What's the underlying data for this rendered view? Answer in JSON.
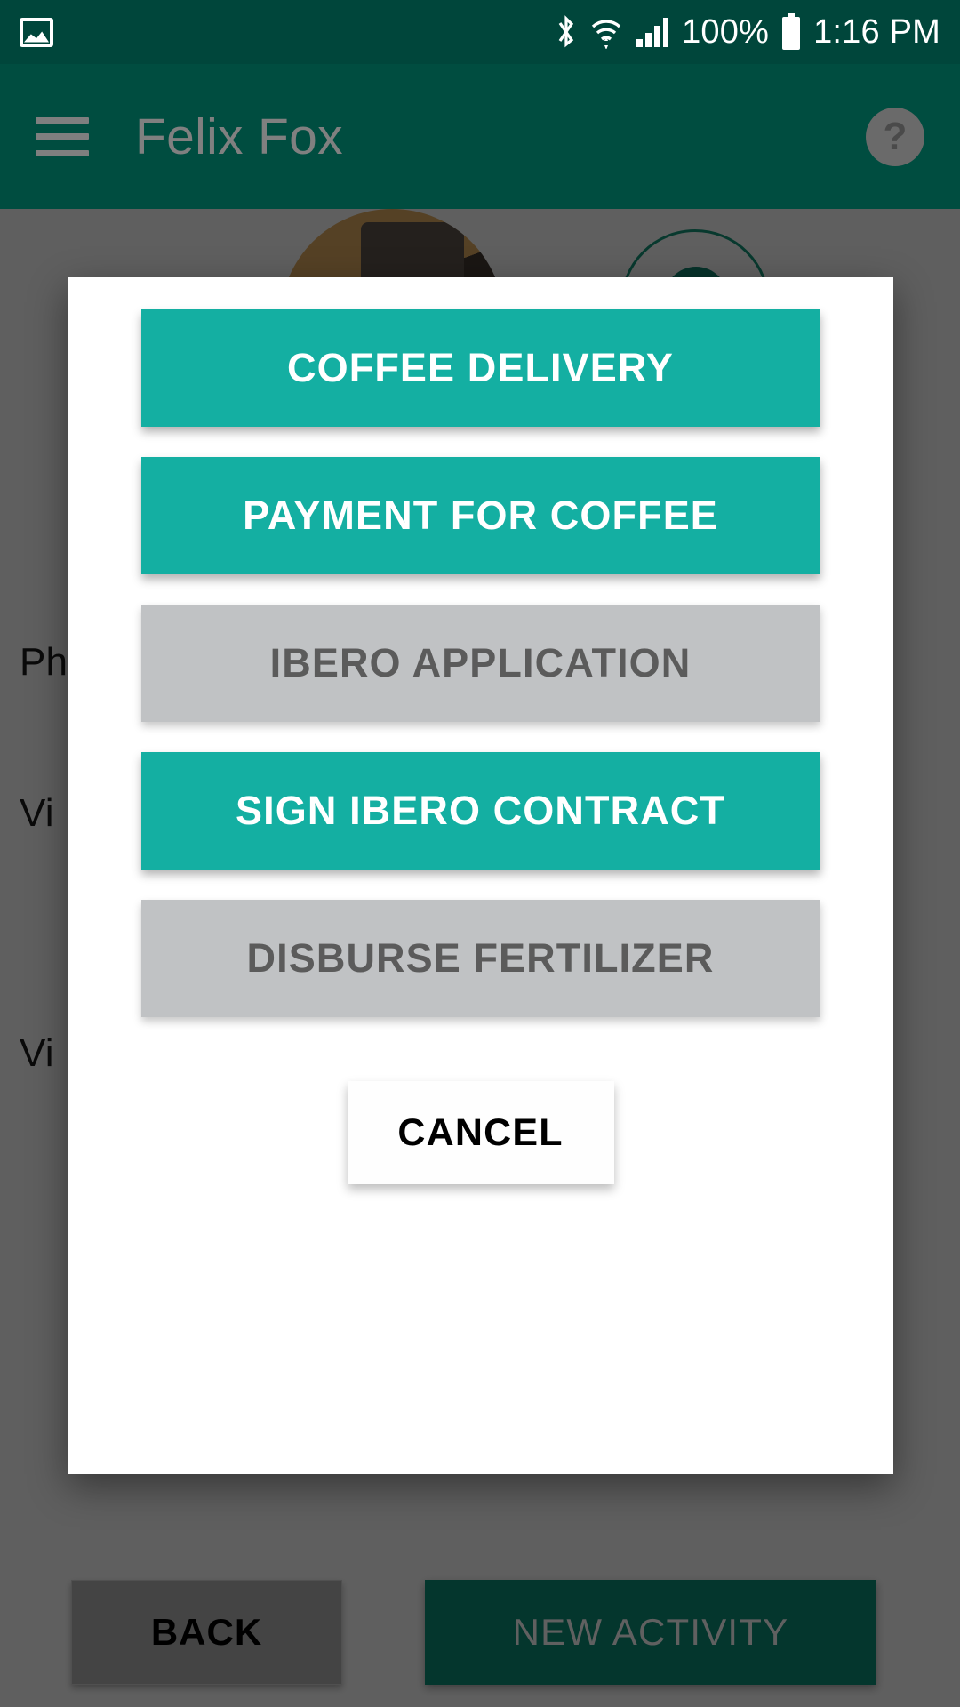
{
  "statusbar": {
    "photo_icon": "photo-icon",
    "bluetooth_icon": "bluetooth-icon",
    "wifi_icon": "wifi-icon",
    "signal_icon": "cellular-signal-icon",
    "battery_percent": "100%",
    "battery_icon": "battery-full-icon",
    "time": "1:16 PM"
  },
  "appbar": {
    "menu_icon": "hamburger-menu-icon",
    "title": "Felix Fox",
    "help_icon": "?",
    "background_color": "#004d40"
  },
  "background": {
    "avatar": "contact-avatar-photo",
    "rows": [
      {
        "label": "Ph"
      },
      {
        "label": "Vi"
      },
      {
        "label": "Vi"
      }
    ],
    "bottom_bar": {
      "back_label": "BACK",
      "new_activity_label": "NEW ACTIVITY",
      "new_activity_color": "#07584a"
    }
  },
  "dialog": {
    "background_color": "#ffffff",
    "enabled_color": "#14afa2",
    "disabled_color": "#c0c2c4",
    "options": [
      {
        "label": "COFFEE DELIVERY",
        "state": "enabled"
      },
      {
        "label": "PAYMENT FOR COFFEE",
        "state": "enabled"
      },
      {
        "label": "IBERO APPLICATION",
        "state": "disabled"
      },
      {
        "label": "SIGN IBERO CONTRACT",
        "state": "enabled"
      },
      {
        "label": "DISBURSE FERTILIZER",
        "state": "disabled"
      }
    ],
    "cancel_label": "CANCEL"
  }
}
